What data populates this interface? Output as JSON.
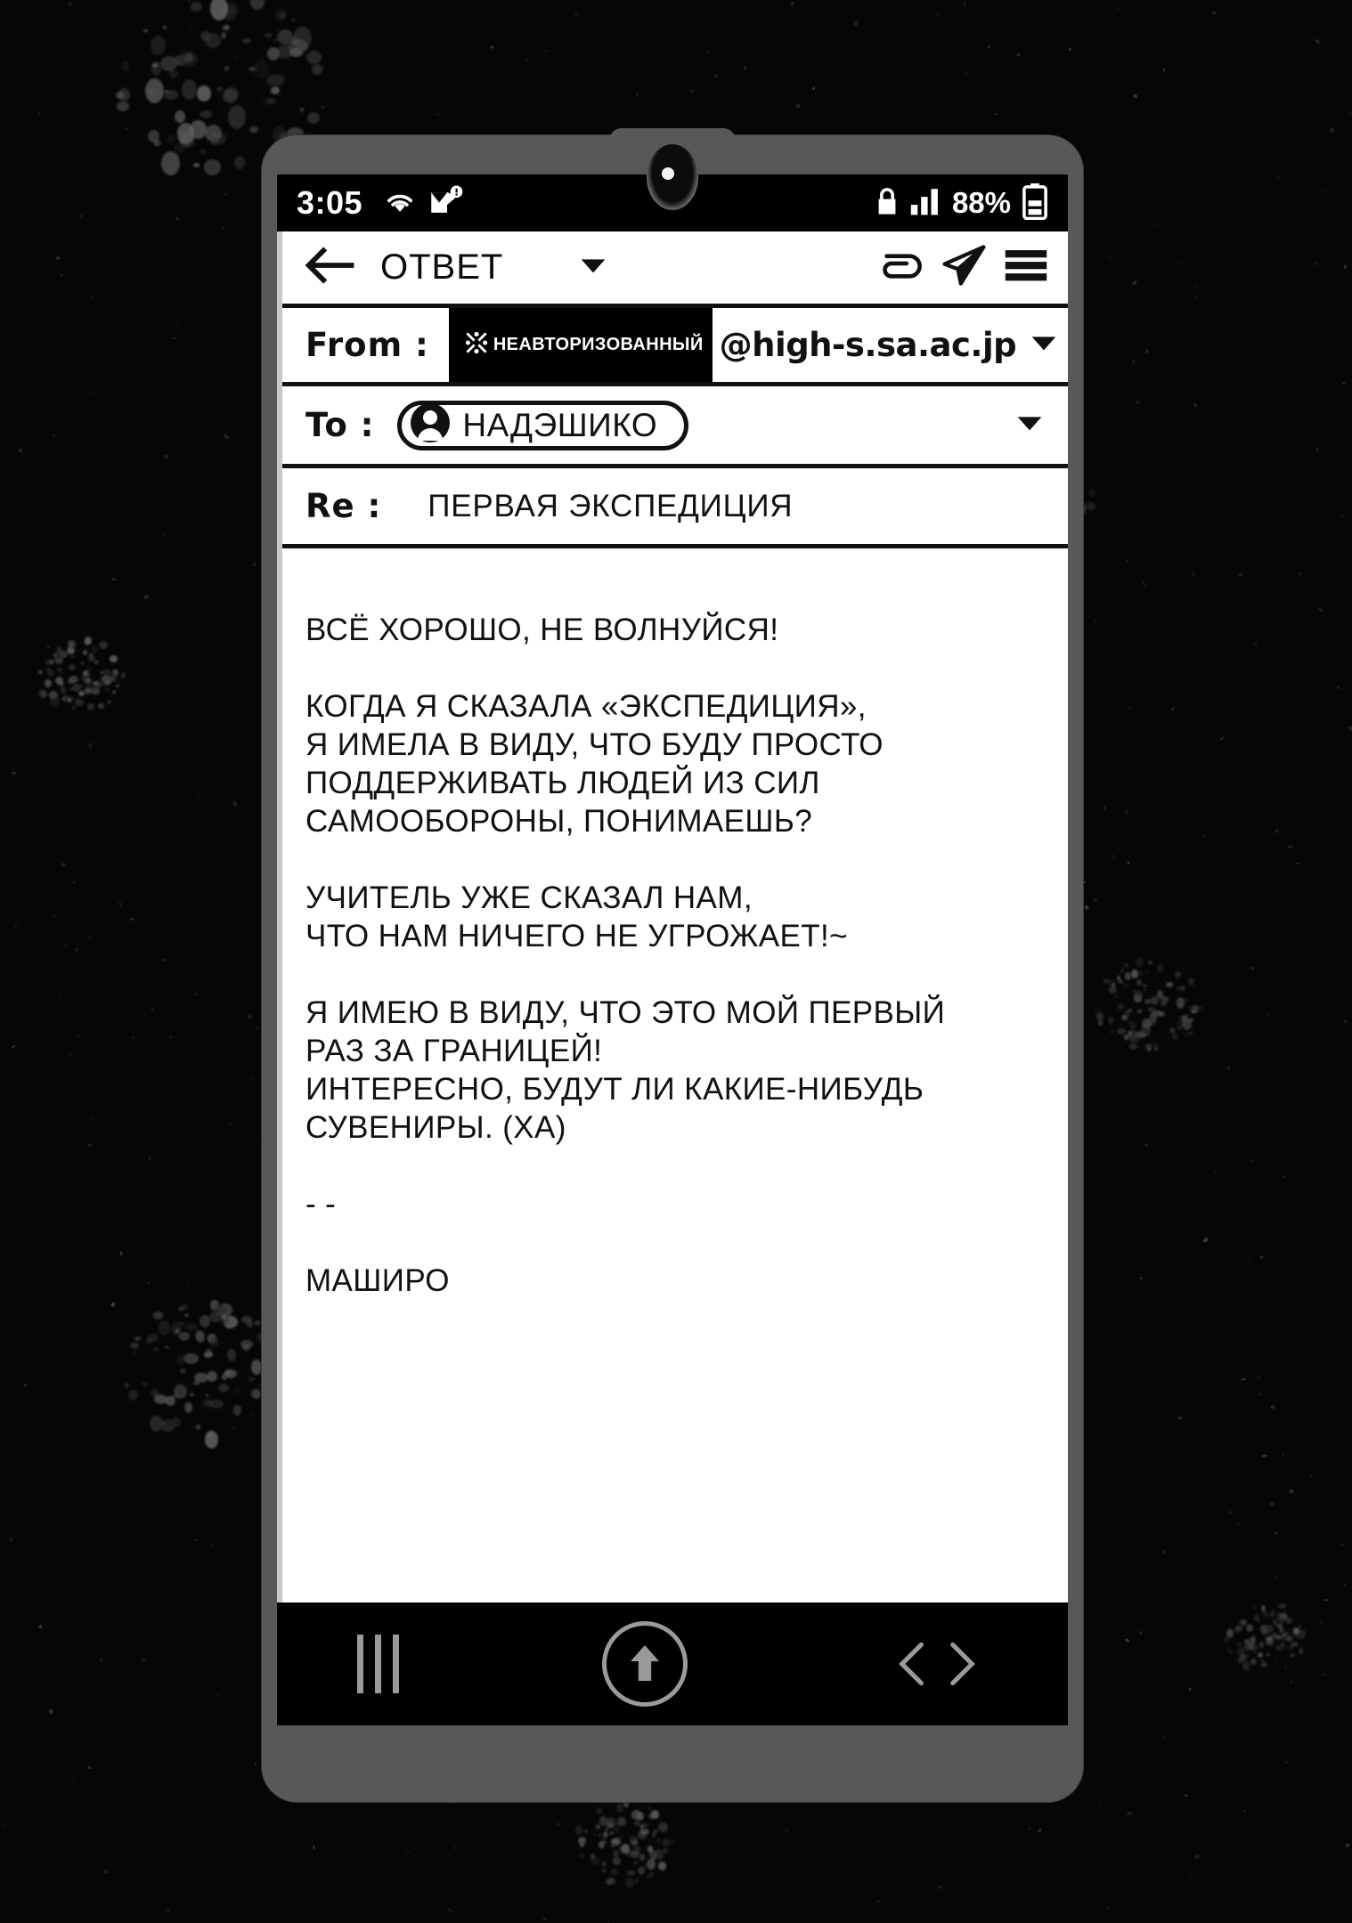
{
  "background": {
    "color": "#060606",
    "texture": "grunge-splatter"
  },
  "device": {
    "frame_color": "#57585a",
    "screen_color": "#000000"
  },
  "statusbar": {
    "time": "3:05",
    "icons": [
      "wifi-icon",
      "mail-alert-icon"
    ],
    "lock_icon": "lock-icon",
    "signal_icon": "signal-bars-icon",
    "battery_text": "88%",
    "battery_icon": "battery-icon"
  },
  "toolbar": {
    "back_icon": "arrow-left-icon",
    "title": "ОТВЕТ",
    "caret_icon": "chevron-down-icon",
    "attach_icon": "paperclip-icon",
    "send_icon": "paper-plane-icon",
    "menu_icon": "hamburger-menu-icon"
  },
  "header": {
    "from": {
      "label": "From :",
      "badge_icon": "x-cross-dots-icon",
      "badge_text": "НЕАВТОРИЗОВАННЫЙ",
      "domain": "@high-s.sa.ac.jp",
      "caret_icon": "chevron-down-icon"
    },
    "to": {
      "label": "To :",
      "avatar_icon": "person-avatar-icon",
      "recipient": "НАДЭШИКО",
      "caret_icon": "chevron-down-icon"
    },
    "re": {
      "label": "Re :",
      "subject": "ПЕРВАЯ ЭКСПЕДИЦИЯ"
    }
  },
  "message": {
    "lines": [
      "ВСЁ ХОРОШО, НЕ ВОЛНУЙСЯ!",
      "",
      "КОГДА Я СКАЗАЛА «ЭКСПЕДИЦИЯ»,",
      "Я ИМЕЛА В ВИДУ, ЧТО БУДУ ПРОСТО",
      "ПОДДЕРЖИВАТЬ ЛЮДЕЙ ИЗ СИЛ",
      "САМООБОРОНЫ, ПОНИМАЕШЬ?",
      "",
      "УЧИТЕЛЬ УЖЕ СКАЗАЛ НАМ,",
      "ЧТО НАМ НИЧЕГО НЕ УГРОЖАЕТ!~",
      "",
      "Я ИМЕЮ В ВИДУ, ЧТО ЭТО МОЙ ПЕРВЫЙ",
      "РАЗ ЗА ГРАНИЦЕЙ!",
      "ИНТЕРЕСНО, БУДУТ ЛИ КАКИЕ-НИБУДЬ",
      "СУВЕНИРЫ. (ХА)",
      "",
      "- -",
      "",
      "МАШИРО"
    ]
  },
  "navbar": {
    "recents_icon": "recents-bars-icon",
    "home_icon": "home-up-arrow-icon",
    "back_icon": "chevron-left-right-icon",
    "tint": "#9a9a9a"
  }
}
